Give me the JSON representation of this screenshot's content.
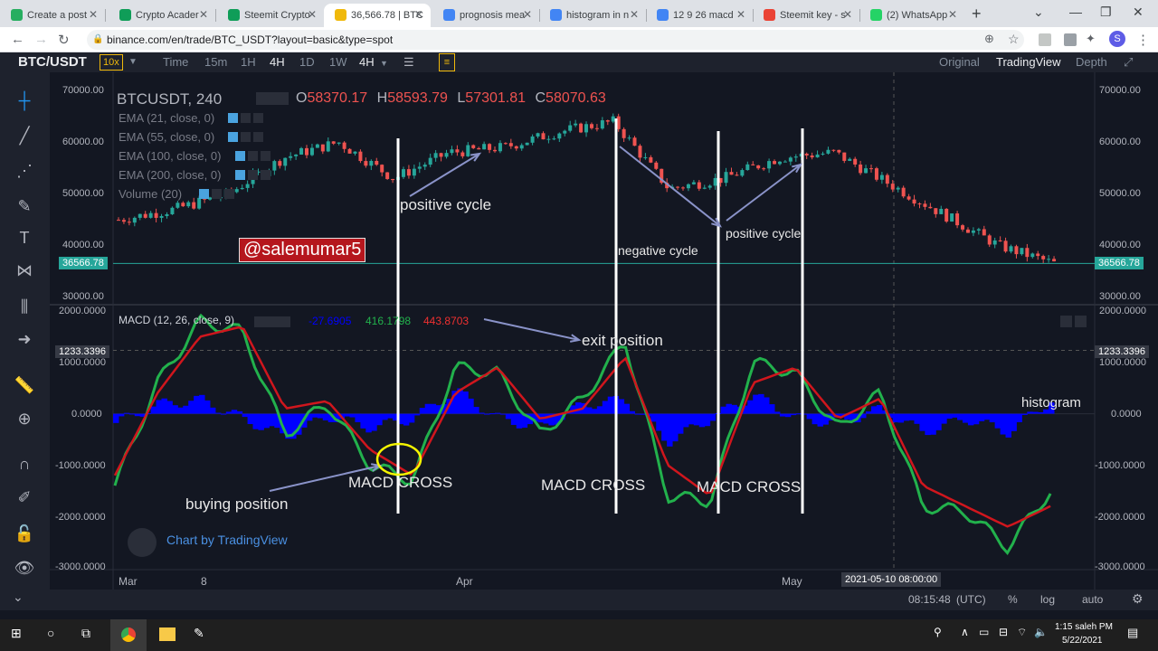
{
  "browser": {
    "tabs": [
      {
        "title": "Create a post",
        "icon_color": "#27ae60",
        "left": 0,
        "width": 116
      },
      {
        "title": "Crypto Acader",
        "icon_color": "#0f9d58",
        "left": 120,
        "width": 118
      },
      {
        "title": "Steemit Crypto",
        "icon_color": "#0f9d58",
        "left": 240,
        "width": 118
      },
      {
        "title": "36,566.78 | BTC",
        "icon_color": "#f0b90b",
        "left": 358,
        "width": 118,
        "active": true
      },
      {
        "title": "prognosis mea",
        "icon_color": "#4285f4",
        "left": 478,
        "width": 118
      },
      {
        "title": "histogram in n",
        "icon_color": "#4285f4",
        "left": 596,
        "width": 118
      },
      {
        "title": "12 9 26 macd",
        "icon_color": "#4285f4",
        "left": 714,
        "width": 118
      },
      {
        "title": "Steemit key - s",
        "icon_color": "#ea4335",
        "left": 832,
        "width": 118
      },
      {
        "title": "(2) WhatsApp",
        "icon_color": "#25d366",
        "left": 950,
        "width": 116
      }
    ],
    "new_tab": "+",
    "url": "binance.com/en/trade/BTC_USDT?layout=basic&type=spot",
    "profile_initial": "S"
  },
  "trade_header": {
    "pair": "BTC/USDT",
    "leverage": "10x",
    "intervals": [
      "Time",
      "15m",
      "1H",
      "4H",
      "1D",
      "1W"
    ],
    "active_interval": "4H",
    "interval_dropdown": "4H",
    "views": [
      "Original",
      "TradingView",
      "Depth"
    ],
    "active_view": "TradingView"
  },
  "main_legend": {
    "symbol": "BTCUSDT, 240",
    "o_label": "O",
    "o": "58370.17",
    "h_label": "H",
    "h": "58593.79",
    "l_label": "L",
    "l": "57301.81",
    "c_label": "C",
    "c": "58070.63",
    "studies": [
      "EMA (21, close, 0)",
      "EMA (55, close, 0)",
      "EMA (100, close, 0)",
      "EMA (200, close, 0)",
      "Volume (20)"
    ]
  },
  "macd_legend": {
    "title": "MACD (12, 26, close, 9)",
    "hist": "-27.6905",
    "macd": "416.1798",
    "signal": "443.8703"
  },
  "price_axis": {
    "labels": [
      "70000.00",
      "60000.00",
      "50000.00",
      "40000.00",
      "30000.00"
    ],
    "current": "36566.78"
  },
  "macd_axis": {
    "labels": [
      "2000.0000",
      "1000.0000",
      "0.0000",
      "-1000.0000",
      "-2000.0000",
      "-3000.0000"
    ],
    "marker": "1233.3396"
  },
  "time_axis": {
    "labels": [
      "Mar",
      "8",
      "Apr",
      "May"
    ],
    "crosshair": "2021-05-10 08:00:00"
  },
  "bottom_bar": {
    "time": "08:15:48",
    "tz": "(UTC)",
    "percent": "%",
    "log": "log",
    "auto": "auto"
  },
  "watermark": {
    "text": "@salemumar5",
    "tradingview": "Chart by TradingView"
  },
  "annotations": {
    "positive_cycle_1": "positive cycle",
    "negative_cycle": "negative cycle",
    "positive_cycle_2": "positive cycle",
    "exit_position": "exit position",
    "histogram": "histogram",
    "buying_position": "buying position",
    "macd_cross_1": "MACD CROSS",
    "macd_cross_2": "MACD CROSS",
    "macd_cross_3": "MACD CROSS"
  },
  "taskbar": {
    "time": "1:15 saleh PM",
    "date": "5/22/2021"
  },
  "colors": {
    "up": "#26a69a",
    "down": "#ef5350",
    "macd": "#22b14c",
    "signal": "#d0161d",
    "hist": "#0000ff",
    "annotation_arrow": "#8a93c9",
    "highlight": "#f5f500"
  },
  "chart_data": [
    {
      "type": "line",
      "title": "BTCUSDT, 240",
      "x": [
        "Mar",
        "8",
        "Apr",
        "May",
        "2021-05-10 08:00:00"
      ],
      "series": [
        {
          "name": "C",
          "values": [
            45000,
            47000,
            50000,
            57000,
            60000,
            53000,
            58000,
            59000,
            62000,
            64000,
            51000,
            53000,
            57000,
            58000,
            52000,
            46000,
            40000,
            36566.78
          ]
        }
      ],
      "ylim": [
        30000,
        70000
      ]
    },
    {
      "type": "line",
      "title": "MACD (12, 26, close, 9)",
      "series": [
        {
          "name": "MACD",
          "values": [
            -1400,
            600,
            1800,
            1600,
            -400,
            200,
            -1000,
            -1300,
            900,
            800,
            -400,
            300,
            1400,
            -1600,
            -1700,
            1000,
            800,
            -300,
            400,
            -1800,
            -1900,
            -2600,
            -1500
          ]
        },
        {
          "name": "Signal",
          "values": [
            -1200,
            400,
            1500,
            1700,
            100,
            250,
            -700,
            -1200,
            400,
            900,
            -100,
            100,
            1100,
            -1000,
            -1600,
            600,
            900,
            -100,
            300,
            -1400,
            -1800,
            -2200,
            -1800
          ]
        }
      ],
      "ylim": [
        -3000,
        2000
      ]
    }
  ]
}
